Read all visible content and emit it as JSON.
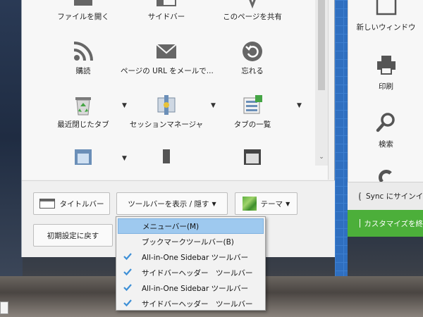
{
  "panel": {
    "items": [
      {
        "label": "ファイルを開く",
        "icon": "folder-open-icon"
      },
      {
        "label": "サイドバー",
        "icon": "sidebar-icon"
      },
      {
        "label": "このページを共有",
        "icon": "share-icon"
      },
      {
        "label": "購読",
        "icon": "rss-icon"
      },
      {
        "label": "ページの URL をメールで...",
        "icon": "email-icon"
      },
      {
        "label": "忘れる",
        "icon": "forget-history-icon"
      },
      {
        "label": "最近閉じたタブ",
        "icon": "recycle-bin-icon"
      },
      {
        "label": "セッションマネージャ",
        "icon": "session-manager-icon"
      },
      {
        "label": "タブの一覧",
        "icon": "tab-list-icon"
      }
    ]
  },
  "toolbar": {
    "titlebar_label": "タイトルバー",
    "show_hide_toolbars_label": "ツールバーを表示 / 隠す",
    "themes_label": "テーマ",
    "restore_defaults_label": "初期設定に戻す"
  },
  "toolbars_menu": {
    "items": [
      {
        "label": "メニューバー(M)",
        "checked": false,
        "highlighted": true
      },
      {
        "label": "ブックマークツールバー(B)",
        "checked": false,
        "highlighted": false
      },
      {
        "label": "All-in-One Sidebar ツールバー",
        "checked": true,
        "highlighted": false
      },
      {
        "label": "サイドバーヘッダー　ツールバー",
        "checked": true,
        "highlighted": false
      },
      {
        "label": "All-in-One Sidebar ツールバー",
        "checked": true,
        "highlighted": false
      },
      {
        "label": "サイドバーヘッダー　ツールバー",
        "checked": true,
        "highlighted": false
      }
    ]
  },
  "right_menu": {
    "items": [
      {
        "label": "新しいウィンドウ",
        "icon": "new-window-icon"
      },
      {
        "label": "印刷",
        "icon": "printer-icon"
      },
      {
        "label": "検索",
        "icon": "search-icon"
      }
    ],
    "sync_label": "Sync にサインイ",
    "customize_label": "カスタマイズを終"
  },
  "colors": {
    "highlight": "#9ec9ef",
    "check": "#3d8fd6",
    "customize_green": "#4caf3a"
  }
}
